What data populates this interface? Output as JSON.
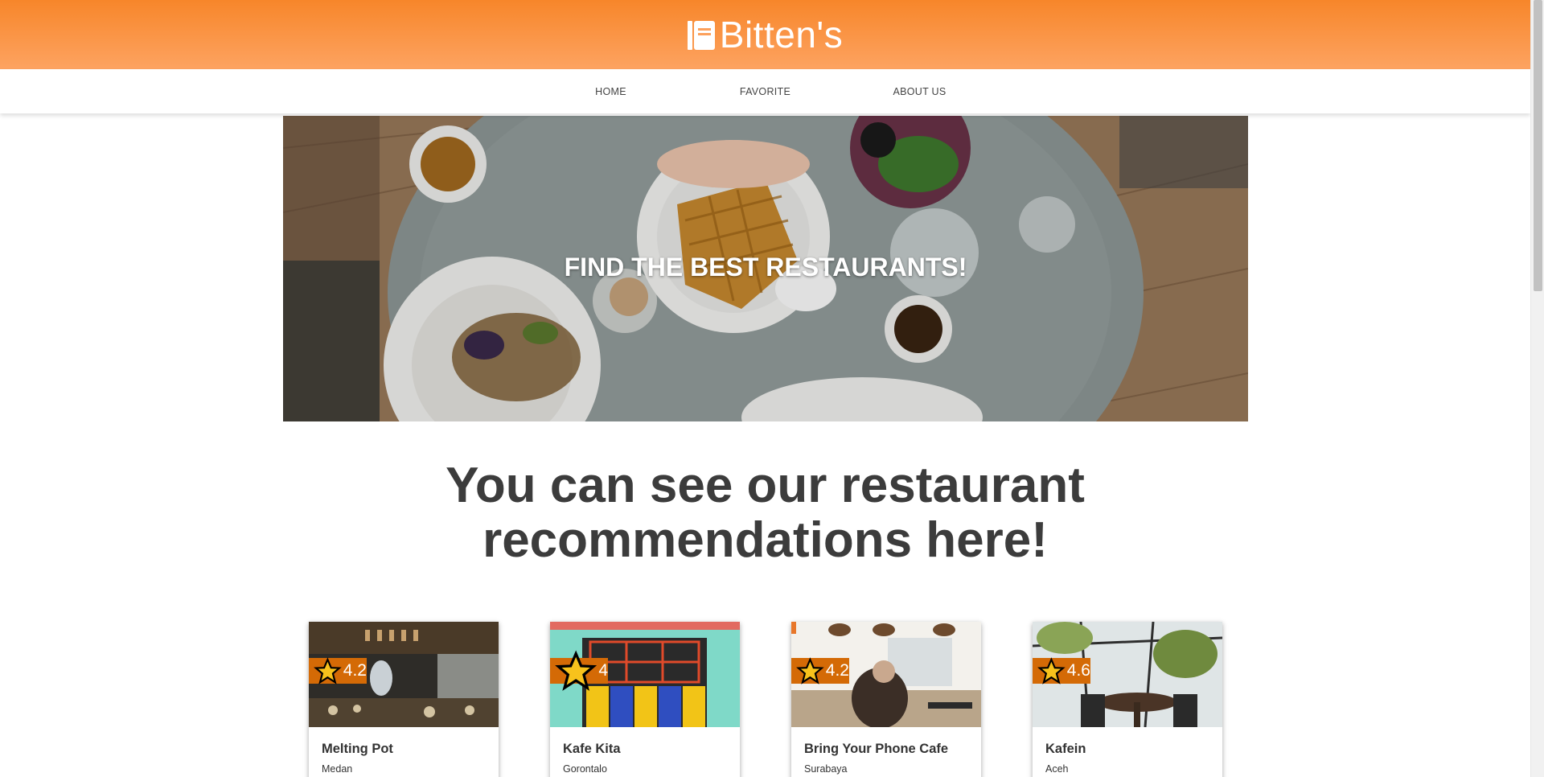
{
  "brand": {
    "name": "Bitten's",
    "icon": "notebook-icon"
  },
  "nav": {
    "items": [
      {
        "label": "HOME"
      },
      {
        "label": "FAVORITE"
      },
      {
        "label": "ABOUT US"
      }
    ]
  },
  "hero": {
    "title": "FIND THE BEST RESTAURANTS!"
  },
  "section": {
    "heading_line1": "You can see our restaurant",
    "heading_line2": "recommendations here!"
  },
  "restaurants": [
    {
      "name": "Melting Pot",
      "city": "Medan",
      "rating": "4.2"
    },
    {
      "name": "Kafe Kita",
      "city": "Gorontalo",
      "rating": "4"
    },
    {
      "name": "Bring Your Phone Cafe",
      "city": "Surabaya",
      "rating": "4.2"
    },
    {
      "name": "Kafein",
      "city": "Aceh",
      "rating": "4.6"
    }
  ],
  "colors": {
    "header_top": "#f7862a",
    "header_bottom": "#fda361",
    "rating_badge": "#d46a06",
    "heading_text": "#3c3c3c"
  }
}
